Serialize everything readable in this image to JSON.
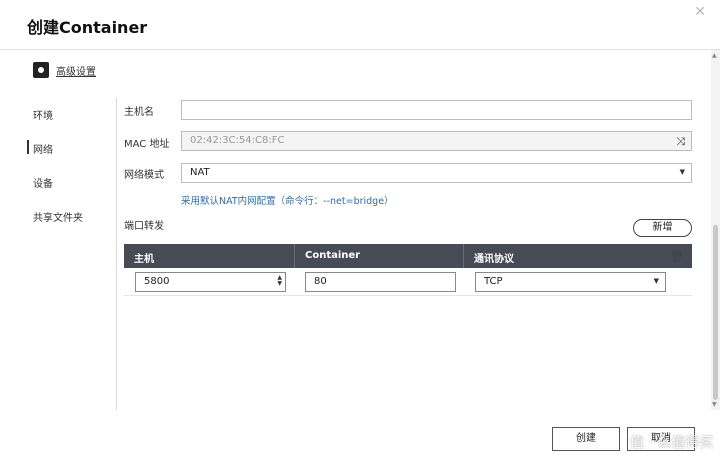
{
  "window": {
    "title": "创建Container"
  },
  "advanced": {
    "label": "高级设置"
  },
  "sidebar": {
    "items": [
      {
        "label": "环境"
      },
      {
        "label": "网络"
      },
      {
        "label": "设备"
      },
      {
        "label": "共享文件夹"
      }
    ],
    "active_index": 1
  },
  "network": {
    "hostname_label": "主机名",
    "hostname_value": "",
    "mac_label": "MAC 地址",
    "mac_value": "02:42:3C:54:C8:FC",
    "mode_label": "网络模式",
    "mode_value": "NAT",
    "mode_hint": "采用默认NAT内网配置（命令行：--net=bridge）",
    "port_label": "端口转发",
    "add_label": "新增"
  },
  "port_table": {
    "headers": [
      "主机",
      "Container",
      "通讯协议"
    ],
    "rows": [
      {
        "host": "5800",
        "container": "80",
        "protocol": "TCP"
      }
    ]
  },
  "footer": {
    "create_label": "创建",
    "cancel_label": "取消"
  },
  "watermark": "值 · 么值得买",
  "colors": {
    "table_header": "#464b55",
    "hint_text": "#2e6da4"
  }
}
